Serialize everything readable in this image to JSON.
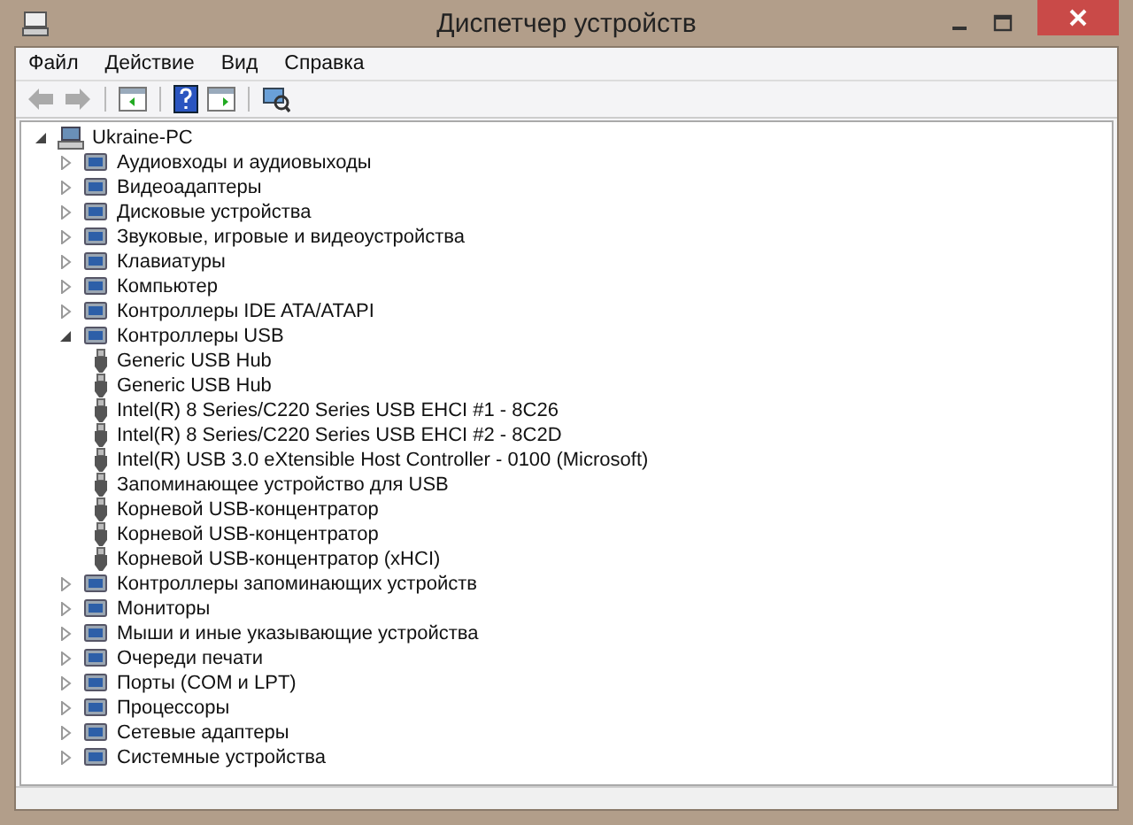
{
  "window": {
    "title": "Диспетчер устройств"
  },
  "menu": [
    "Файл",
    "Действие",
    "Вид",
    "Справка"
  ],
  "tree": {
    "label": "Ukraine-PC",
    "expanded": true,
    "children": [
      {
        "label": "Аудиовходы и аудиовыходы",
        "expanded": false
      },
      {
        "label": "Видеоадаптеры",
        "expanded": false
      },
      {
        "label": "Дисковые устройства",
        "expanded": false
      },
      {
        "label": "Звуковые, игровые и видеоустройства",
        "expanded": false
      },
      {
        "label": "Клавиатуры",
        "expanded": false
      },
      {
        "label": "Компьютер",
        "expanded": false
      },
      {
        "label": "Контроллеры IDE ATA/ATAPI",
        "expanded": false
      },
      {
        "label": "Контроллеры USB",
        "expanded": true,
        "children": [
          {
            "label": "Generic USB Hub"
          },
          {
            "label": "Generic USB Hub"
          },
          {
            "label": "Intel(R) 8 Series/C220 Series USB EHCI #1 - 8C26"
          },
          {
            "label": "Intel(R) 8 Series/C220 Series USB EHCI #2 - 8C2D"
          },
          {
            "label": "Intel(R) USB 3.0 eXtensible Host Controller - 0100 (Microsoft)"
          },
          {
            "label": "Запоминающее устройство для USB"
          },
          {
            "label": "Корневой USB-концентратор"
          },
          {
            "label": "Корневой USB-концентратор"
          },
          {
            "label": "Корневой USB-концентратор (xHCI)"
          }
        ]
      },
      {
        "label": "Контроллеры запоминающих устройств",
        "expanded": false
      },
      {
        "label": "Мониторы",
        "expanded": false
      },
      {
        "label": "Мыши и иные указывающие устройства",
        "expanded": false
      },
      {
        "label": "Очереди печати",
        "expanded": false
      },
      {
        "label": "Порты (COM и LPT)",
        "expanded": false
      },
      {
        "label": "Процессоры",
        "expanded": false
      },
      {
        "label": "Сетевые адаптеры",
        "expanded": false
      },
      {
        "label": "Системные устройства",
        "expanded": false
      }
    ]
  }
}
